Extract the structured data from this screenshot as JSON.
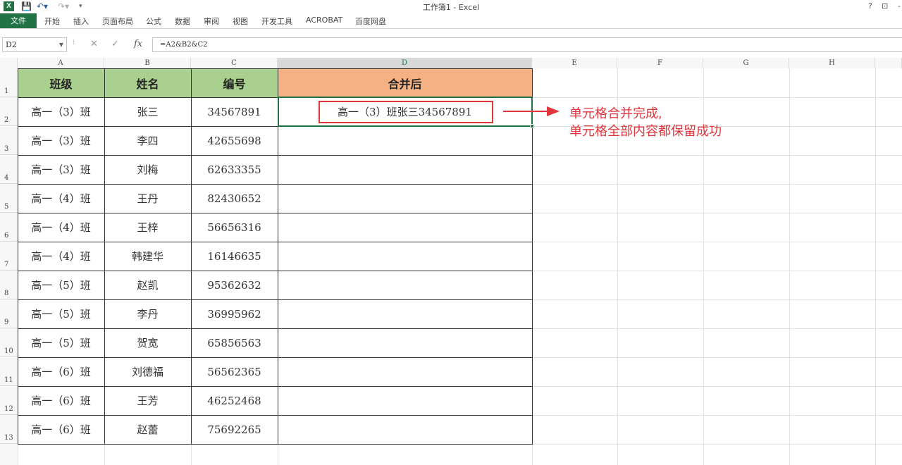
{
  "window": {
    "title": "工作簿1 - Excel",
    "help": "?",
    "restore": "⊡",
    "minimize": "-"
  },
  "ribbon": {
    "file": "文件",
    "tabs": [
      "开始",
      "插入",
      "页面布局",
      "公式",
      "数据",
      "审阅",
      "视图",
      "开发工具",
      "ACROBAT",
      "百度网盘"
    ]
  },
  "formula_bar": {
    "name_box": "D2",
    "fx": "fx",
    "formula": "=A2&B2&C2"
  },
  "columns": [
    "A",
    "B",
    "C",
    "D",
    "E",
    "F",
    "G",
    "H"
  ],
  "selected_column": "D",
  "rows": [
    "1",
    "2",
    "3",
    "4",
    "5",
    "6",
    "7",
    "8",
    "9",
    "10",
    "11",
    "12",
    "13"
  ],
  "table": {
    "header": [
      "班级",
      "姓名",
      "编号",
      "合并后"
    ],
    "rows": [
      [
        "高一（3）班",
        "张三",
        "34567891",
        "高一（3）班张三34567891"
      ],
      [
        "高一（3）班",
        "李四",
        "42655698",
        ""
      ],
      [
        "高一（3）班",
        "刘梅",
        "62633355",
        ""
      ],
      [
        "高一（4）班",
        "王丹",
        "82430652",
        ""
      ],
      [
        "高一（4）班",
        "王梓",
        "56656316",
        ""
      ],
      [
        "高一（4）班",
        "韩建华",
        "16146635",
        ""
      ],
      [
        "高一（5）班",
        "赵凯",
        "95362632",
        ""
      ],
      [
        "高一（5）班",
        "李丹",
        "36995962",
        ""
      ],
      [
        "高一（5）班",
        "贺宽",
        "65856563",
        ""
      ],
      [
        "高一（6）班",
        "刘德福",
        "56562365",
        ""
      ],
      [
        "高一（6）班",
        "王芳",
        "46252468",
        ""
      ],
      [
        "高一（6）班",
        "赵蕾",
        "75692265",
        ""
      ]
    ]
  },
  "annotation": {
    "line1": "单元格合并完成,",
    "line2": "单元格全部内容都保留成功"
  },
  "colors": {
    "header_green": "#a9d08e",
    "header_orange": "#f4b183",
    "excel_green": "#217346",
    "annotation_red": "#e0353b"
  }
}
